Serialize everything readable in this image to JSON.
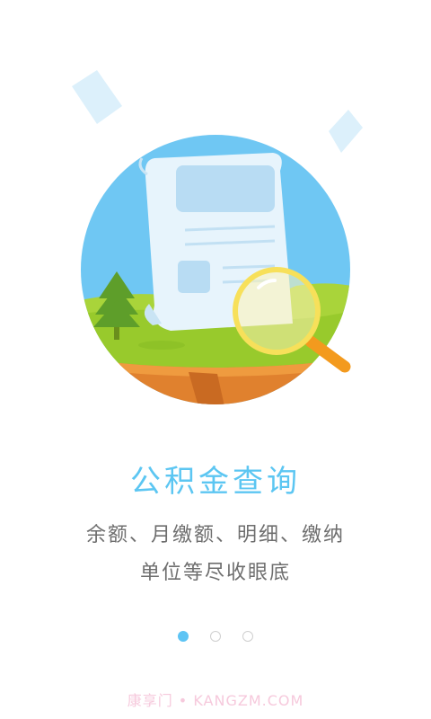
{
  "onboarding": {
    "title": "公积金查询",
    "description_line1": "余额、月缴额、明细、缴纳",
    "description_line2": "单位等尽收眼底",
    "pager": {
      "total": 3,
      "active_index": 0
    }
  },
  "watermark": "康享门 • KANGZM.COM",
  "colors": {
    "accent": "#5cc6f2",
    "sky": "#6fc7f3",
    "grass": "#9ccf30",
    "cliff": "#e0812e",
    "lens_ring": "#f7e05a",
    "handle": "#f39a1e"
  },
  "icons": [
    "document-icon",
    "magnifier-icon",
    "tree-icon",
    "paper-icon"
  ]
}
